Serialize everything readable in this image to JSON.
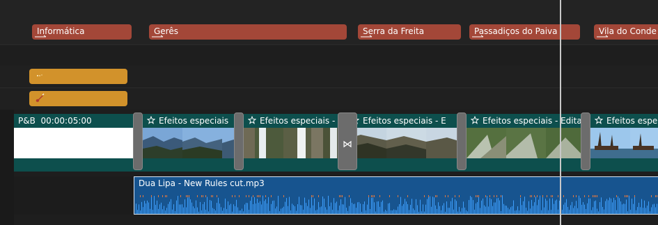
{
  "colors": {
    "title_marker": "#a34738",
    "fx_marker": "#d2922b",
    "video_clip": "#0d4f4d",
    "audio_clip": "#17548f",
    "playhead": "#c8c8c8"
  },
  "title_track": {
    "markers": [
      "Informática",
      "Gerês",
      "Serra da Freita",
      "Passadiços do Paiva",
      "Vila do Conde"
    ]
  },
  "fx_track": {
    "items": [
      {
        "icon": "sparkle-icon"
      },
      {
        "icon": "guitar-icon"
      }
    ]
  },
  "video_track": {
    "pb_clip": {
      "label": "P&B",
      "duration": "00:00:05:00"
    },
    "clips": [
      {
        "label": "Efeitos especiais",
        "icon": "star-icon"
      },
      {
        "label": "Efeitos especiais - Ei",
        "icon": "star-icon"
      },
      {
        "label": "Efeitos especiais - E",
        "icon": "star-icon"
      },
      {
        "label": "Efeitos especiais - Edita",
        "icon": "star-icon"
      },
      {
        "label": "Efeitos espe",
        "icon": "star-icon"
      }
    ],
    "transition_icon": "⋈"
  },
  "audio_track": {
    "clip_label": "Dua Lipa - New Rules cut.mp3"
  }
}
